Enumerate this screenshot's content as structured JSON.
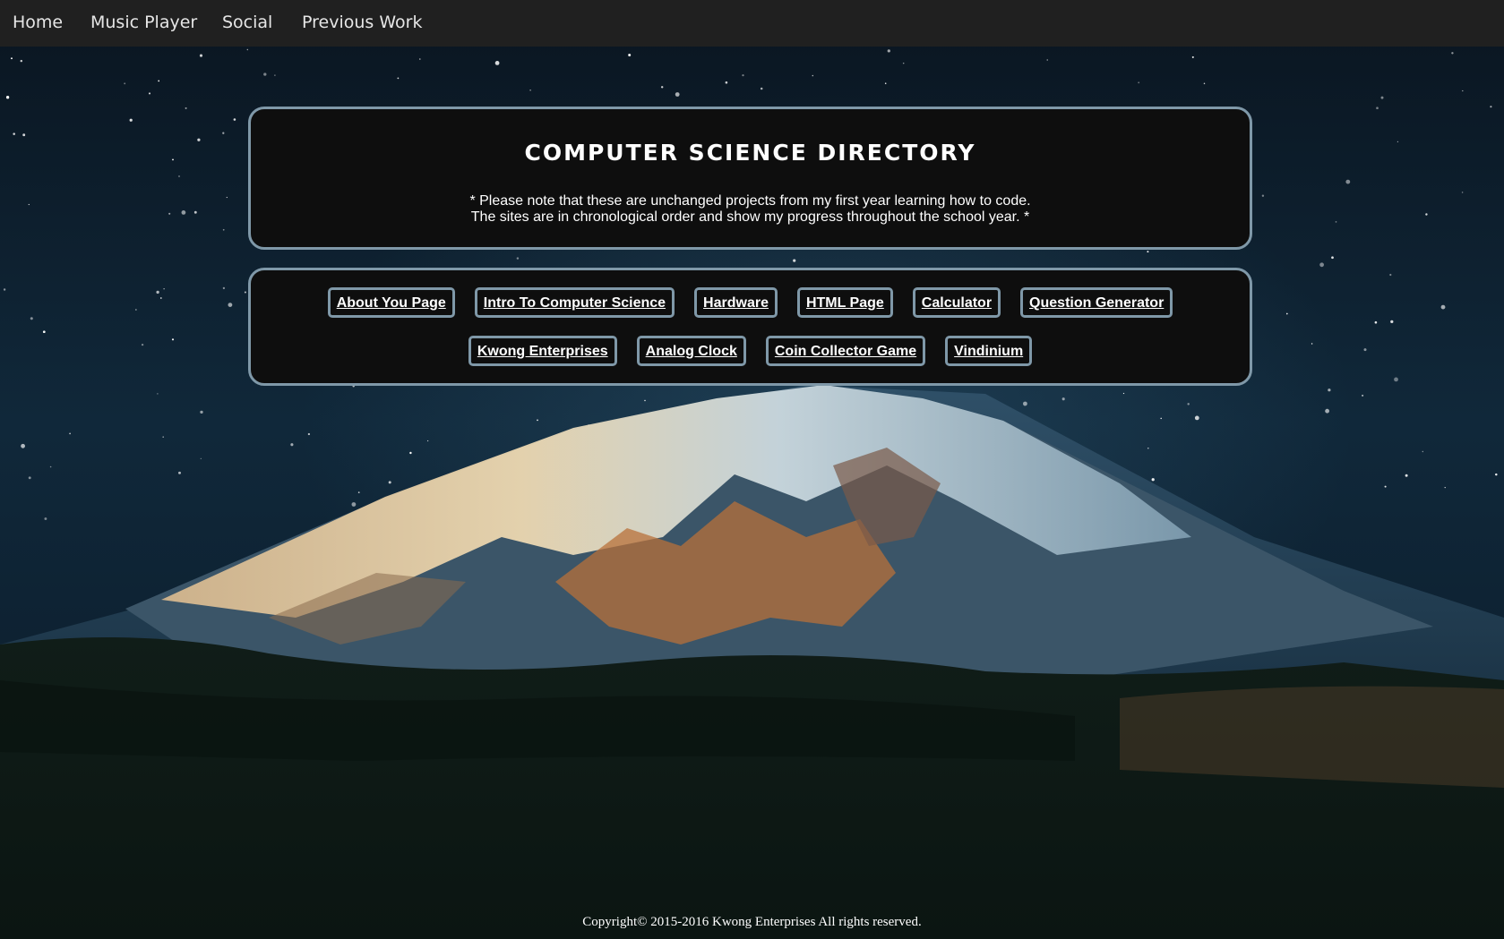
{
  "nav": {
    "items": [
      {
        "label": "Home"
      },
      {
        "label": "Music Player"
      },
      {
        "label": "Social"
      },
      {
        "label": "Previous Work"
      }
    ]
  },
  "header": {
    "title": "COMPUTER SCIENCE DIRECTORY",
    "note_line1": "* Please note that these are unchanged projects from my first year learning how to code.",
    "note_line2": "The sites are in chronological order and show my progress throughout the school year. *"
  },
  "projects": {
    "row1": [
      "About You Page",
      "Intro To Computer Science",
      "Hardware",
      "HTML Page",
      "Calculator",
      "Question Generator"
    ],
    "row2": [
      "Kwong Enterprises",
      "Analog Clock",
      "Coin Collector Game",
      "Vindinium"
    ]
  },
  "footer": {
    "copyright": "Copyright© 2015-2016 Kwong Enterprises All rights reserved."
  },
  "colors": {
    "nav_bg": "#202020",
    "panel_bg": "#0e0e0e",
    "panel_border": "#7f98a8",
    "sky": "#0b1a26"
  }
}
